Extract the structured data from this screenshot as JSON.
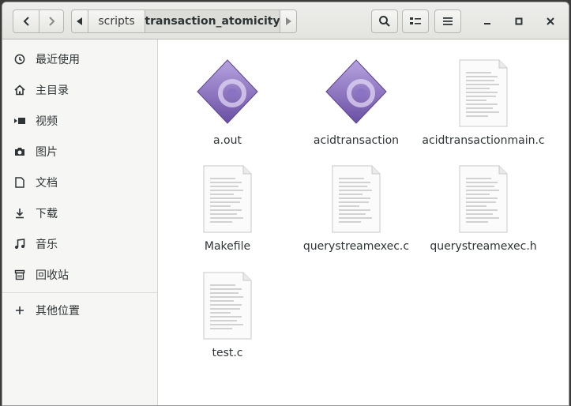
{
  "toolbar": {
    "back_icon": "chevron-left-icon",
    "forward_icon": "chevron-right-icon",
    "search_icon": "search-icon",
    "view_icon": "list-view-icon",
    "menu_icon": "hamburger-menu-icon"
  },
  "pathbar": {
    "crumbs": [
      "scripts",
      "transaction_atomicity"
    ]
  },
  "window": {
    "minimize": "–",
    "maximize": "□",
    "close": "×"
  },
  "sidebar": {
    "items": [
      {
        "label": "最近使用",
        "icon": "clock-icon"
      },
      {
        "label": "主目录",
        "icon": "home-icon"
      },
      {
        "label": "视频",
        "icon": "video-icon"
      },
      {
        "label": "图片",
        "icon": "camera-icon"
      },
      {
        "label": "文档",
        "icon": "document-icon"
      },
      {
        "label": "下载",
        "icon": "download-icon"
      },
      {
        "label": "音乐",
        "icon": "music-icon"
      },
      {
        "label": "回收站",
        "icon": "trash-icon"
      }
    ],
    "other": {
      "label": "其他位置",
      "icon": "plus-icon"
    }
  },
  "files": [
    {
      "name": "a.out",
      "type": "executable"
    },
    {
      "name": "acidtransaction",
      "type": "executable"
    },
    {
      "name": "acidtransactionmain.c",
      "type": "text"
    },
    {
      "name": "Makefile",
      "type": "text"
    },
    {
      "name": "querystreamexec.c",
      "type": "text"
    },
    {
      "name": "querystreamexec.h",
      "type": "text"
    },
    {
      "name": "test.c",
      "type": "text"
    }
  ],
  "colors": {
    "exec_icon_light": "#a78fd6",
    "exec_icon_dark": "#6a4fa3"
  }
}
